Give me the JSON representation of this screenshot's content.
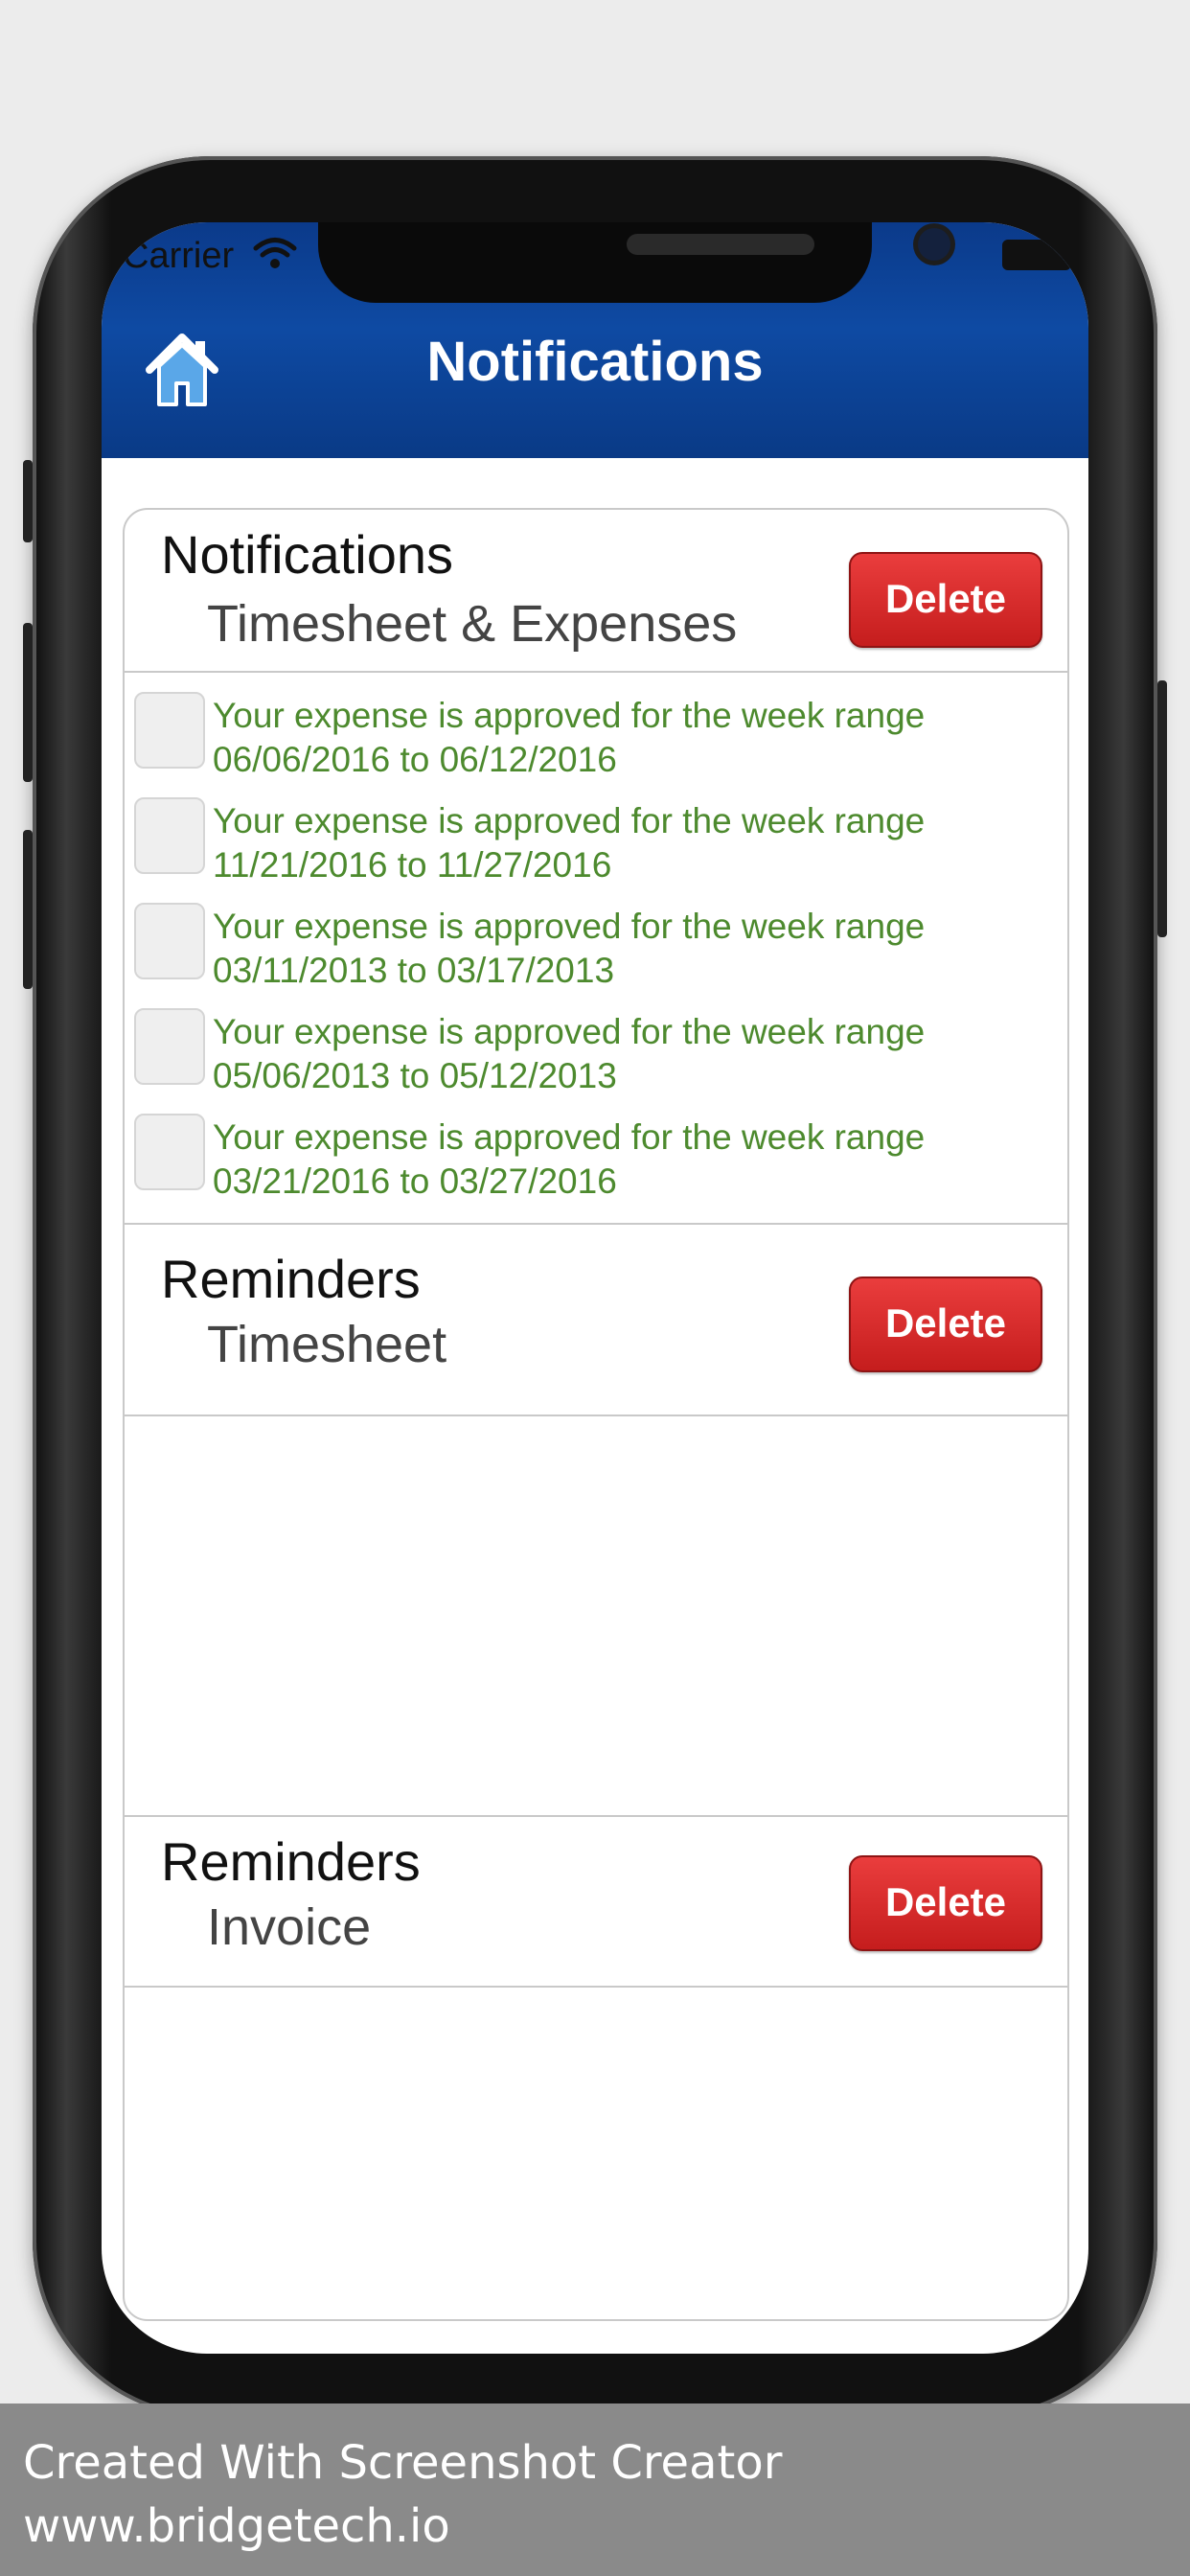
{
  "status_bar": {
    "carrier": "Carrier"
  },
  "navbar": {
    "title": "Notifications"
  },
  "sections": {
    "notifications": {
      "title": "Notifications",
      "subtitle": "Timesheet & Expenses",
      "delete_label": "Delete"
    },
    "reminders_timesheet": {
      "title": "Reminders",
      "subtitle": "Timesheet",
      "delete_label": "Delete"
    },
    "reminders_invoice": {
      "title": "Reminders",
      "subtitle": "Invoice",
      "delete_label": "Delete"
    }
  },
  "notification_items": [
    {
      "text": "Your expense is approved for the week range 06/06/2016 to 06/12/2016",
      "checked": false
    },
    {
      "text": "Your expense is approved for the week range 11/21/2016 to 11/27/2016",
      "checked": false
    },
    {
      "text": "Your expense is approved for the week range 03/11/2013 to 03/17/2013",
      "checked": false
    },
    {
      "text": "Your expense is approved for the week range 05/06/2013 to 05/12/2013",
      "checked": false
    },
    {
      "text": "Your expense is approved for the week range 03/21/2016 to 03/27/2016",
      "checked": false
    }
  ],
  "footer": {
    "line1": "Created With Screenshot Creator",
    "line2": "www.bridgetech.io"
  },
  "colors": {
    "navbar": "#0e4aa3",
    "delete": "#d12a2a",
    "item_text": "#4d8a2e"
  },
  "icons": {
    "home": "home-icon",
    "wifi": "wifi-icon",
    "battery": "battery-icon"
  }
}
